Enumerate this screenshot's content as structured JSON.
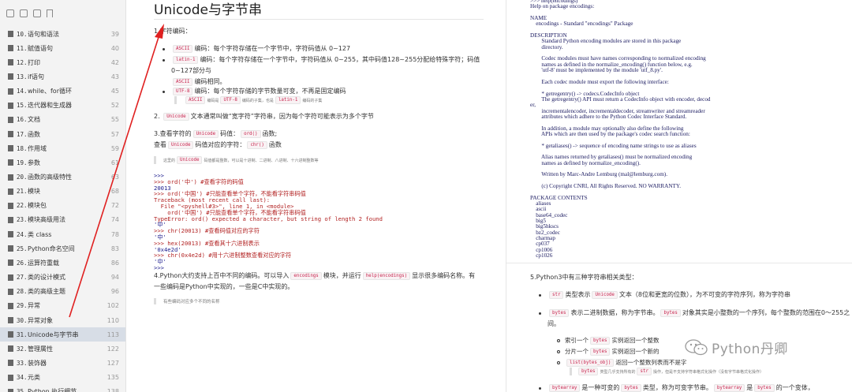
{
  "sidebar": {
    "items": [
      {
        "num": "10.",
        "label": "语句和语法",
        "page": "39"
      },
      {
        "num": "11.",
        "label": "赋值语句",
        "page": "40"
      },
      {
        "num": "12.",
        "label": "打印",
        "page": "42"
      },
      {
        "num": "13.",
        "label": "if语句",
        "page": "43"
      },
      {
        "num": "14.",
        "label": "while、for循环",
        "page": "45"
      },
      {
        "num": "15.",
        "label": "迭代器和生成器",
        "page": "52"
      },
      {
        "num": "16.",
        "label": "文档",
        "page": "55"
      },
      {
        "num": "17.",
        "label": "函数",
        "page": "57"
      },
      {
        "num": "18.",
        "label": "作用域",
        "page": "59"
      },
      {
        "num": "19.",
        "label": "参数",
        "page": "61"
      },
      {
        "num": "20.",
        "label": "函数的高级特性",
        "page": "63"
      },
      {
        "num": "21.",
        "label": "模块",
        "page": "68"
      },
      {
        "num": "22.",
        "label": "模块包",
        "page": "72"
      },
      {
        "num": "23.",
        "label": "模块高级用法",
        "page": "74"
      },
      {
        "num": "24.",
        "label": "类 class",
        "page": "78"
      },
      {
        "num": "25.",
        "label": "Python命名空间",
        "page": "83"
      },
      {
        "num": "26.",
        "label": "运算符重载",
        "page": "86"
      },
      {
        "num": "27.",
        "label": "类的设计模式",
        "page": "94"
      },
      {
        "num": "28.",
        "label": "类的高级主题",
        "page": "96"
      },
      {
        "num": "29.",
        "label": "异常",
        "page": "102"
      },
      {
        "num": "30.",
        "label": "异常对象",
        "page": "110"
      },
      {
        "num": "31.",
        "label": "Unicode与字节串",
        "page": "113"
      },
      {
        "num": "32.",
        "label": "管理属性",
        "page": "122"
      },
      {
        "num": "33.",
        "label": "装饰器",
        "page": "127"
      },
      {
        "num": "34.",
        "label": "元类",
        "page": "135"
      },
      {
        "num": "35.",
        "label": "Python 执行细节",
        "page": "138"
      }
    ],
    "active_index": 21
  },
  "middle": {
    "title": "Unicode与字节串",
    "s1_heading": "1.字符编码：",
    "b1_chip": "ASCII",
    "b1_text": "编码：每个字符存储在一个字节中，字符码值从 0~127",
    "b2_chip": "latin-1",
    "b2_text": "编码：每个字符存储在一个字节中，字符码值从 0~255，其中码值128~255分配给特殊字符；码值",
    "b2_cont": "0~127部分与",
    "b2_chip2": "ASCII",
    "b2_cont2": "编码相同。",
    "b3_chip": "UTF-8",
    "b3_text": "编码：每个字符存储的字节数量可变，不再是固定编码",
    "b3_note_chip1": "ASCII",
    "b3_note_a": "编码是",
    "b3_note_chip2": "UTF-8",
    "b3_note_b": "编码的子集，也是",
    "b3_note_chip3": "latin-1",
    "b3_note_c": "编码的子集",
    "s2_prefix": "2.",
    "s2_chip": "Unicode",
    "s2_text": "文本通常叫做“宽字符”字符串，因为每个字符可能表示为多个字节",
    "s3_a": "3.查看字符的",
    "s3_chip1": "Unicode",
    "s3_b": "码值：",
    "s3_chip2": "ord()",
    "s3_c": "函数;",
    "s3_d": "查看",
    "s3_chip3": "Unicode",
    "s3_e": "码值对应的字符：",
    "s3_chip4": "chr()",
    "s3_f": "函数",
    "note1_a": "这里的",
    "note1_chip": "Unicode",
    "note1_b": "码值都是整数，可以是十进制、二进制、八进制、十六进制整数等",
    "code": [
      {
        "t": ">>>",
        "c": "blue"
      },
      {
        "t": ">>> ord('中') #查看字符的码值",
        "c": "red"
      },
      {
        "t": "20013",
        "c": "blue"
      },
      {
        "t": ">>> ord('中国') #只能查看单个字符，不能看字符串码值",
        "c": "red"
      },
      {
        "t": "Traceback (most recent call last):",
        "c": "red"
      },
      {
        "t": "  File \"<pyshell#3>\", line 1, in <module>",
        "c": "red"
      },
      {
        "t": "    ord('中国') #只能查看单个字符，不能看字符串码值",
        "c": "red"
      },
      {
        "t": "TypeError: ord() expected a character, but string of length 2 found",
        "c": "red"
      },
      {
        "t": "'中'",
        "c": "blue"
      },
      {
        "t": ">>> chr(20013) #查看码值对应的字符",
        "c": "red"
      },
      {
        "t": "'中'",
        "c": "blue"
      },
      {
        "t": ">>> hex(20013) #查看其十六进制表示",
        "c": "red"
      },
      {
        "t": "'0x4e2d'",
        "c": "blue"
      },
      {
        "t": ">>> chr(0x4e2d) #用十六进制整数查看对应的字符",
        "c": "red"
      },
      {
        "t": "'中'",
        "c": "blue"
      },
      {
        "t": ">>>",
        "c": "blue"
      }
    ],
    "s4_a": "4.Python大约支持上百中不同的编码。可以导入",
    "s4_chip1": "encodings",
    "s4_b": "模块，并运行",
    "s4_chip2": "help(encodings)",
    "s4_c": "显示很多编码名称。有",
    "s4_d": "一些编码是Python中实现的，一些是C中实现的。",
    "note2": "有些编码对应多个不同的名称"
  },
  "right": {
    "help_lines": [
      ">>> help(encodings)",
      "Help on package encodings:",
      "",
      "NAME",
      "    encodings - Standard \"encodings\" Package",
      "",
      "DESCRIPTION",
      "        Standard Python encoding modules are stored in this package",
      "        directory.",
      "",
      "        Codec modules must have names corresponding to normalized encoding",
      "        names as defined in the normalize_encoding() function below, e.g.",
      "        'utf-8' must be implemented by the module 'utf_8.py'.",
      "",
      "        Each codec module must export the following interface:",
      "",
      "        * getregentry() -> codecs.CodecInfo object",
      "        The getregentry() API must return a CodecInfo object with encoder, decod",
      "er,",
      "        incrementalencoder, incrementaldecoder, streamwriter and streamreader",
      "        attributes which adhere to the Python Codec Interface Standard.",
      "",
      "        In addition, a module may optionally also define the following",
      "        APIs which are then used by the package's codec search function:",
      "",
      "        * getaliases() -> sequence of encoding name strings to use as aliases",
      "",
      "        Alias names returned by getaliases() must be normalized encoding",
      "        names as defined by normalize_encoding().",
      "",
      "        Written by Marc-Andre Lemburg (mal@lemburg.com).",
      "",
      "        (c) Copyright CNRI, All Rights Reserved. NO WARRANTY.",
      "",
      "PACKAGE CONTENTS",
      "    aliases",
      "    ascii",
      "    base64_codec",
      "    big5",
      "    big5hkscs",
      "    bz2_codec",
      "    charmap",
      "    cp037",
      "    cp1006",
      "    cp1026"
    ],
    "s5_heading": "5.Python3中有三种字符串相关类型：",
    "r_b1_chip": "str",
    "r_b1_a": "类型表示",
    "r_b1_chip2": "Unicode",
    "r_b1_b": "文本（8位和更宽的位数），为不可变的字符序列，称为字符串",
    "r_b2_chip": "bytes",
    "r_b2_a": "表示二进制数据，称为字节串。",
    "r_b2_chip2": "bytes",
    "r_b2_b": "对象其实是小整数的一个序列，每个整数的范围在0～255之",
    "r_b2_cont": "间。",
    "sub1_a": "索引一个",
    "sub1_chip": "bytes",
    "sub1_b": "实例返回一个整数",
    "sub2_a": "分片一个",
    "sub2_chip": "bytes",
    "sub2_b": "实例返回一个新的",
    "sub3_chip": "list(bytes_obj)",
    "sub3_b": "返回一个整数列表而不是字",
    "rnote_chip1": "bytes",
    "rnote_a": "类型几乎支持所有的",
    "rnote_chip2": "str",
    "rnote_b": "操作，但是不支持字符串格式化操作（没有字节串格式化操作）",
    "r_b3_chip": "bytearray",
    "r_b3_a": "是一种可变的",
    "r_b3_chip2": "bytes",
    "r_b3_b": "类型，称为可变字节串。",
    "r_b3_chip3": "bytearray",
    "r_b3_c": "是",
    "r_b3_chip4": "bytes",
    "r_b3_d": "的一个变体，"
  },
  "watermark": {
    "text": "Python丹卿"
  },
  "colors": {
    "accent_arrow": "#e02020",
    "chip_text": "#c7254e",
    "active_toc": "#d7dde6"
  }
}
